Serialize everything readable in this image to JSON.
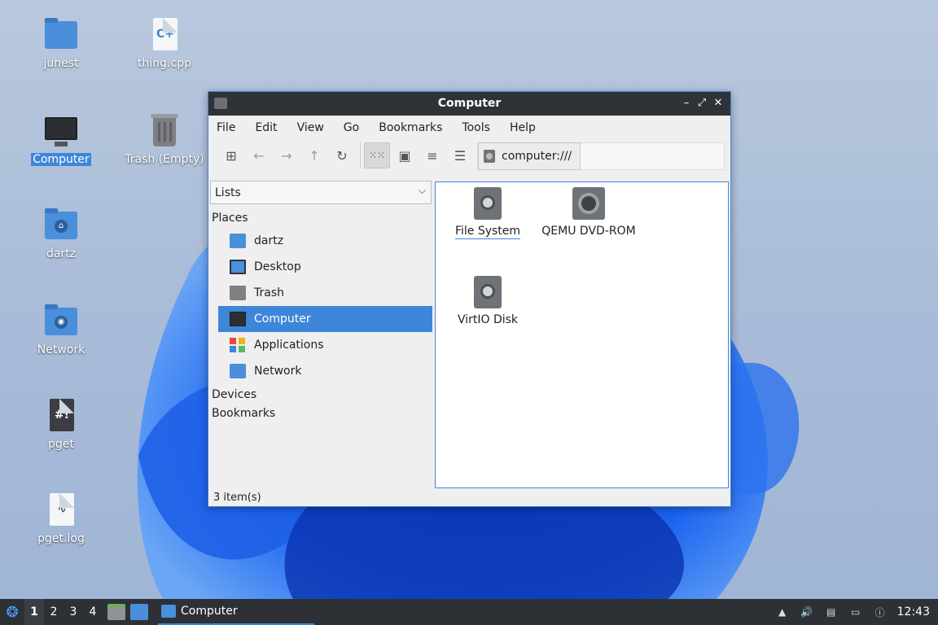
{
  "desktop": {
    "icons": [
      {
        "label": "junest"
      },
      {
        "label": "thing.cpp"
      },
      {
        "label": "Computer"
      },
      {
        "label": "Trash (Empty)"
      },
      {
        "label": "dartz"
      },
      {
        "label": "Network"
      },
      {
        "label": "pget"
      },
      {
        "label": "pget.log"
      }
    ]
  },
  "window": {
    "title": "Computer",
    "controls": {
      "minimize": "–",
      "maximize": "⤢",
      "close": "✕"
    },
    "menu": [
      "File",
      "Edit",
      "View",
      "Go",
      "Bookmarks",
      "Tools",
      "Help"
    ],
    "address": "computer:///",
    "sidebar": {
      "selector": "Lists",
      "sections": {
        "places": "Places",
        "devices": "Devices",
        "bookmarks": "Bookmarks"
      },
      "places": [
        {
          "label": "dartz",
          "icon": "home-folder-icon"
        },
        {
          "label": "Desktop",
          "icon": "desktop-icon"
        },
        {
          "label": "Trash",
          "icon": "trash-icon"
        },
        {
          "label": "Computer",
          "icon": "computer-icon"
        },
        {
          "label": "Applications",
          "icon": "applications-icon"
        },
        {
          "label": "Network",
          "icon": "network-folder-icon"
        }
      ]
    },
    "files": [
      {
        "name": "File System",
        "icon": "drive-icon"
      },
      {
        "name": "QEMU DVD-ROM",
        "icon": "optical-drive-icon"
      },
      {
        "name": "VirtIO Disk",
        "icon": "drive-icon"
      }
    ],
    "status": "3 item(s)"
  },
  "taskbar": {
    "workspaces": [
      "1",
      "2",
      "3",
      "4"
    ],
    "task": "Computer",
    "clock": "12:43"
  },
  "colors": {
    "accent": "#3d86d8",
    "titlebar": "#2f3338",
    "taskbar": "#2d3035"
  }
}
